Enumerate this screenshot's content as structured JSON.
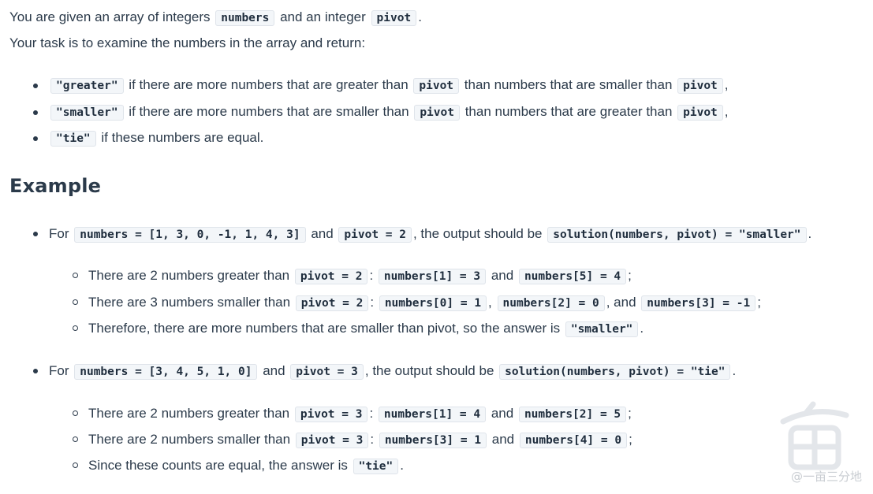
{
  "intro": {
    "line1": [
      "You are given an array of integers ",
      "numbers",
      " and an integer ",
      "pivot",
      "."
    ],
    "line2": "Your task is to examine the numbers in the array and return:"
  },
  "rules": [
    [
      "\"greater\"",
      " if there are more numbers that are greater than ",
      "pivot",
      " than numbers that are smaller than ",
      "pivot",
      ","
    ],
    [
      "\"smaller\"",
      " if there are more numbers that are smaller than ",
      "pivot",
      " than numbers that are greater than ",
      "pivot",
      ","
    ],
    [
      "\"tie\"",
      " if these numbers are equal."
    ]
  ],
  "example_heading": "Example",
  "examples": [
    {
      "intro": [
        "For ",
        "numbers = [1, 3, 0, -1, 1, 4, 3]",
        " and ",
        "pivot = 2",
        ", the output should be ",
        "solution(numbers, pivot) = \"smaller\"",
        "."
      ],
      "details": [
        [
          "There are 2 numbers greater than ",
          "pivot = 2",
          ": ",
          "numbers[1] = 3",
          " and ",
          "numbers[5] = 4",
          ";"
        ],
        [
          "There are 3 numbers smaller than ",
          "pivot = 2",
          ": ",
          "numbers[0] = 1",
          ", ",
          "numbers[2] = 0",
          ", and ",
          "numbers[3] = -1",
          ";"
        ],
        [
          "Therefore, there are more numbers that are smaller than pivot, so the answer is ",
          "\"smaller\"",
          "."
        ]
      ]
    },
    {
      "intro": [
        "For ",
        "numbers = [3, 4, 5, 1, 0]",
        " and ",
        "pivot = 3",
        ", the output should be ",
        "solution(numbers, pivot) = \"tie\"",
        "."
      ],
      "details": [
        [
          "There are 2 numbers greater than ",
          "pivot = 3",
          ": ",
          "numbers[1] = 4",
          " and ",
          "numbers[2] = 5",
          ";"
        ],
        [
          "There are 2 numbers smaller than ",
          "pivot = 3",
          ": ",
          "numbers[3] = 1",
          " and ",
          "numbers[4] = 0",
          ";"
        ],
        [
          "Since these counts are equal, the answer is ",
          "\"tie\"",
          "."
        ]
      ]
    }
  ],
  "watermark": {
    "text": "@一亩三分地"
  }
}
